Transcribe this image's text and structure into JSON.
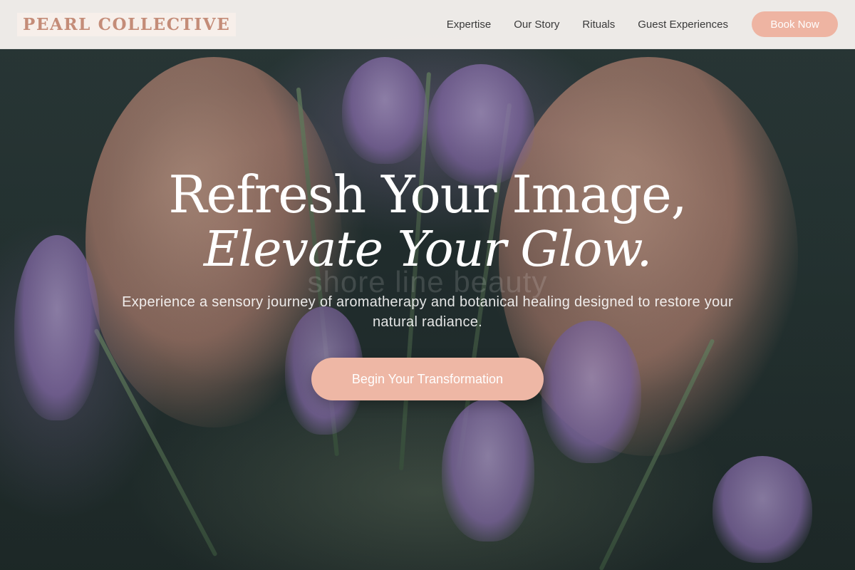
{
  "brand": {
    "name": "PEARL COLLECTIVE"
  },
  "nav": {
    "items": [
      {
        "label": "Expertise"
      },
      {
        "label": "Our Story"
      },
      {
        "label": "Rituals"
      },
      {
        "label": "Guest Experiences"
      }
    ],
    "book_label": "Book Now"
  },
  "hero": {
    "title_line1": "Refresh Your Image,",
    "title_line2": "Elevate Your Glow.",
    "watermark": "shore line beauty",
    "subtitle": "Experience a sensory journey of aromatherapy and botanical healing designed to restore your natural radiance.",
    "cta_label": "Begin Your Transformation"
  },
  "colors": {
    "accent": "#eeb4a2",
    "logo": "#c48c78",
    "header_bg": "#f6f1ee"
  }
}
